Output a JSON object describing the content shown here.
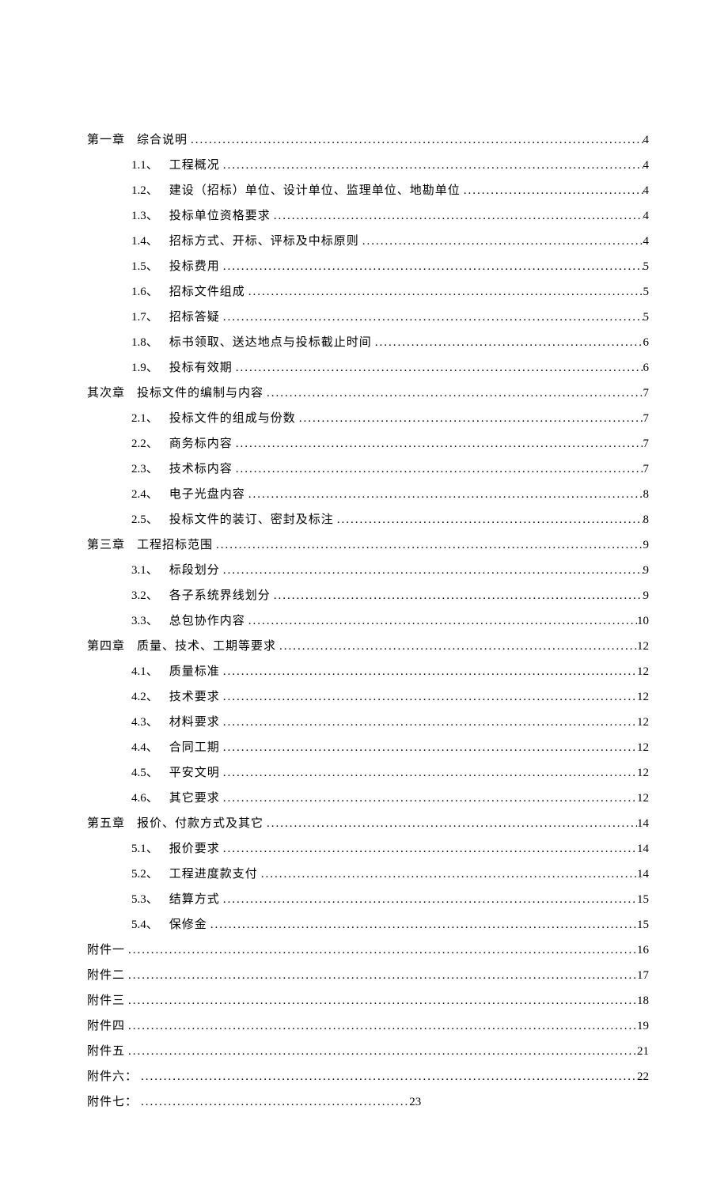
{
  "toc": [
    {
      "type": "chapter",
      "label": "第一章",
      "title": "综合说明",
      "page": "4"
    },
    {
      "type": "section",
      "number": "1.1、",
      "title": "工程概况",
      "page": "4"
    },
    {
      "type": "section",
      "number": "1.2、",
      "title": "建设（招标）单位、设计单位、监理单位、地勘单位",
      "page": "4"
    },
    {
      "type": "section",
      "number": "1.3、",
      "title": "投标单位资格要求",
      "page": "4"
    },
    {
      "type": "section",
      "number": "1.4、",
      "title": "招标方式、开标、评标及中标原则",
      "page": "4"
    },
    {
      "type": "section",
      "number": "1.5、",
      "title": "投标费用",
      "page": "5"
    },
    {
      "type": "section",
      "number": "1.6、",
      "title": "招标文件组成",
      "page": "5"
    },
    {
      "type": "section",
      "number": "1.7、",
      "title": "招标答疑",
      "page": "5"
    },
    {
      "type": "section",
      "number": "1.8、",
      "title": "标书领取、送达地点与投标截止时间",
      "page": "6"
    },
    {
      "type": "section",
      "number": "1.9、",
      "title": "投标有效期",
      "page": "6"
    },
    {
      "type": "chapter",
      "label": "其次章",
      "title": "投标文件的编制与内容",
      "page": "7"
    },
    {
      "type": "section",
      "number": "2.1、",
      "title": "投标文件的组成与份数",
      "page": "7"
    },
    {
      "type": "section",
      "number": "2.2、",
      "title": "商务标内容",
      "page": "7"
    },
    {
      "type": "section",
      "number": "2.3、",
      "title": "技术标内容",
      "page": "7"
    },
    {
      "type": "section",
      "number": "2.4、",
      "title": "电子光盘内容",
      "page": "8"
    },
    {
      "type": "section",
      "number": "2.5、",
      "title": "投标文件的装订、密封及标注",
      "page": "8"
    },
    {
      "type": "chapter",
      "label": "第三章",
      "title": "工程招标范围",
      "page": "9"
    },
    {
      "type": "section",
      "number": "3.1、",
      "title": "标段划分",
      "page": "9"
    },
    {
      "type": "section",
      "number": "3.2、",
      "title": "各子系统界线划分",
      "page": "9"
    },
    {
      "type": "section",
      "number": "3.3、",
      "title": "总包协作内容",
      "page": "10"
    },
    {
      "type": "chapter",
      "label": "第四章",
      "title": "质量、技术、工期等要求",
      "page": "12"
    },
    {
      "type": "section",
      "number": "4.1、",
      "title": "质量标准",
      "page": "12"
    },
    {
      "type": "section",
      "number": "4.2、",
      "title": "技术要求",
      "page": "12"
    },
    {
      "type": "section",
      "number": "4.3、",
      "title": "材料要求",
      "page": "12"
    },
    {
      "type": "section",
      "number": "4.4、",
      "title": "合同工期",
      "page": "12"
    },
    {
      "type": "section",
      "number": "4.5、",
      "title": "平安文明",
      "page": "12"
    },
    {
      "type": "section",
      "number": "4.6、",
      "title": "其它要求",
      "page": "12"
    },
    {
      "type": "chapter",
      "label": "第五章",
      "title": "报价、付款方式及其它",
      "page": "14"
    },
    {
      "type": "section",
      "number": "5.1、",
      "title": "报价要求",
      "page": "14"
    },
    {
      "type": "section",
      "number": "5.2、",
      "title": "工程进度款支付",
      "page": "14"
    },
    {
      "type": "section",
      "number": "5.3、",
      "title": "结算方式",
      "page": "15"
    },
    {
      "type": "section",
      "number": "5.4、",
      "title": "保修金",
      "page": "15"
    },
    {
      "type": "attachment",
      "label": "附件一",
      "page": "16"
    },
    {
      "type": "attachment",
      "label": "附件二",
      "page": "17"
    },
    {
      "type": "attachment",
      "label": "附件三",
      "page": "18"
    },
    {
      "type": "attachment",
      "label": "附件四",
      "page": "19"
    },
    {
      "type": "attachment",
      "label": "附件五",
      "page": "21"
    },
    {
      "type": "attachment",
      "label": "附件六：",
      "page": "22"
    },
    {
      "type": "attachment",
      "label": "附件七：",
      "page": "23",
      "shortdots": true
    }
  ]
}
